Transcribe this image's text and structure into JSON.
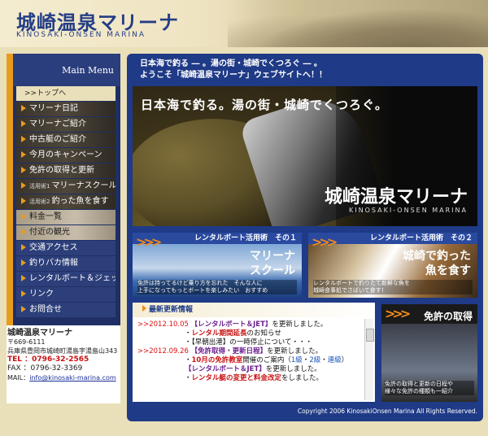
{
  "header": {
    "title": "城崎温泉マリーナ",
    "subtitle": "KINOSAKI-ONSEN MARINA"
  },
  "sidebar": {
    "main_menu_label": "Main Menu",
    "top_link": ">>トップへ",
    "items": [
      {
        "label": "マリーナ日記"
      },
      {
        "label": "マリーナご紹介"
      },
      {
        "label": "中古艇のご紹介"
      },
      {
        "label": "今月のキャンペーン"
      },
      {
        "label": "免許の取得と更新"
      },
      {
        "tag": "活用術1",
        "label": "マリーナスクール"
      },
      {
        "tag": "活用術2",
        "label": "釣った魚を食す"
      },
      {
        "label": "料金一覧"
      },
      {
        "label": "付近の観光"
      },
      {
        "label": "交通アクセス"
      },
      {
        "label": "釣りバカ情報"
      },
      {
        "label": "レンタルボート＆ジェット"
      },
      {
        "label": "リンク"
      },
      {
        "label": "お問合せ"
      }
    ]
  },
  "contact": {
    "name": "城崎温泉マリーナ",
    "zip": "〒669-6111",
    "address": "兵庫県豊岡市城崎町湯島字湯島山343",
    "tel": "TEL ：0796-32-2565",
    "fax": "FAX ：0796-32-3369",
    "mail_label": "MAIL：",
    "mail": "info@kinosaki-marina.com"
  },
  "main": {
    "intro_line1": "日本海で釣る ― 。湯の街・城崎でくつろぐ ― 。",
    "intro_line2": "ようこそ「城崎温泉マリーナ」ウェブサイトへ！！",
    "hero_caption": "日本海で釣る。湯の街・城崎でくつろぐ。",
    "hero_name": "城崎温泉マリーナ",
    "hero_sub": "KINOSAKI-ONSEN MARINA",
    "card1": {
      "header": "レンタルボート活用術　その１",
      "title1": "マリーナ",
      "title2": "スクール",
      "text1": "免許は持ってるけど乗り方を忘れた",
      "text2": "上手になってもっとボートを楽しみたい",
      "text3": "そんな人に",
      "text4": "おすすめ"
    },
    "card2": {
      "header": "レンタルボート活用術　その２",
      "title1": "城崎で釣った",
      "title2": "魚を食す",
      "text1": "レンタルボートで釣りたて新鮮な魚を",
      "text2": "城崎食事処でさばいて食す！"
    },
    "news": {
      "heading": "最新更新情報",
      "entries": [
        {
          "date": ">>2012.10.05",
          "link": "【レンタルボート＆JET】",
          "text": "を更新しました。"
        },
        {
          "bullet": "・",
          "red": "レンタル期間延長",
          "text": "のお知らせ"
        },
        {
          "bullet": "・",
          "text": "【早朝出港】の一時停止について・・・"
        },
        {
          "date": ">>2012.09.26",
          "link": "【免許取得・更新日程】",
          "text": "を更新しました。"
        },
        {
          "bullet": "・",
          "red": "10月の免許教室",
          "text": "開催のご案内（",
          "blue1": "1級",
          "sep": "・",
          "blue2": "2級",
          "sep2": "・",
          "blue3": "連級",
          "end": "）"
        },
        {
          "link": "【レンタルボート＆JET】",
          "text": "を更新しました。"
        },
        {
          "bullet": "・",
          "red": "レンタル艇の変更と料金改定",
          "text": "をしました。"
        }
      ]
    },
    "license": {
      "title": "免許の取得",
      "text1": "免許の取得と更新の日程や",
      "text2": "様々な免許の種類も一紹介"
    },
    "footer": "Copyright 2006 KinosakiOnsen Marina All Rights Reserved."
  }
}
